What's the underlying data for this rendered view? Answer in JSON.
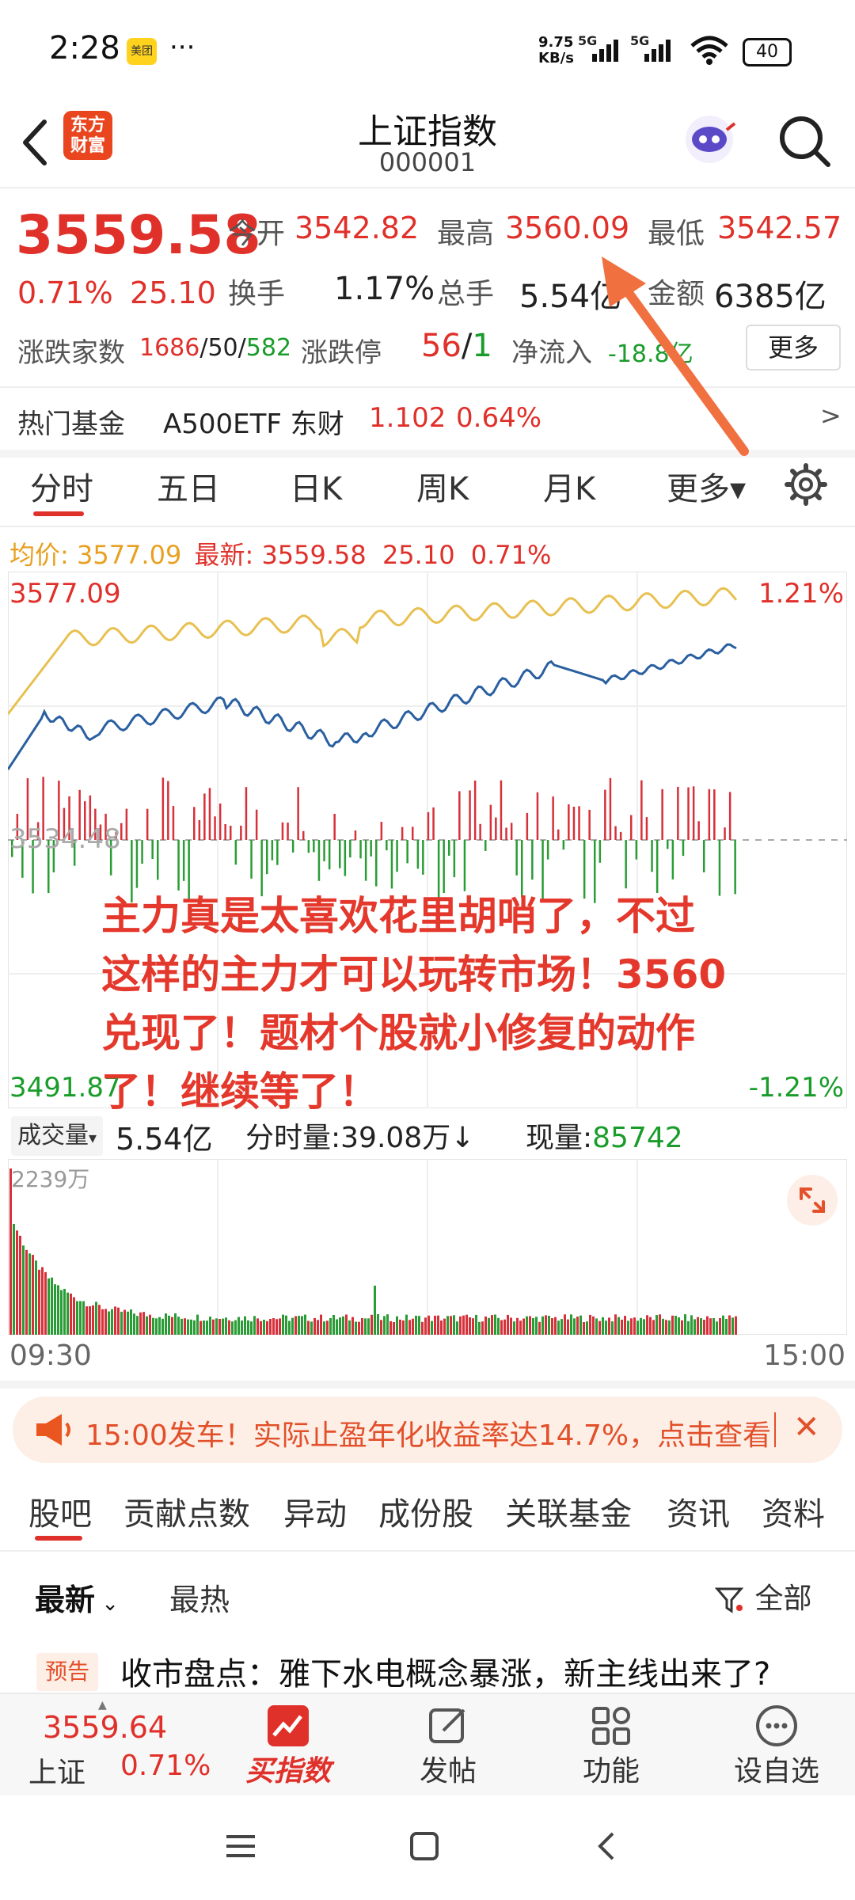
{
  "status_bar": {
    "time": "2:28",
    "app_badge": "美团",
    "dots": "···",
    "net_speed_top": "9.75",
    "net_speed_bottom": "KB/s",
    "sig1": "5G",
    "sig2": "5G",
    "battery": "40"
  },
  "header": {
    "title": "上证指数",
    "code": "000001",
    "logo_line1": "东方",
    "logo_line2": "财富"
  },
  "quote": {
    "price": "3559.58",
    "change_pct": "0.71%",
    "change": "25.10",
    "open_label": "今开",
    "open": "3542.82",
    "high_label": "最高",
    "high": "3560.09",
    "low_label": "最低",
    "low": "3542.57",
    "turnover_label": "换手",
    "turnover": "1.17%",
    "volume_label": "总手",
    "volume": "5.54亿",
    "amount_label": "金额",
    "amount": "6385亿",
    "breadth_label": "涨跌家数",
    "up_count": "1686",
    "flat_count": "50",
    "down_count": "582",
    "slash": "/",
    "limit_label": "涨跌停",
    "limit_up": "56",
    "limit_down": "1",
    "netflow_label": "净流入",
    "netflow": "-18.8亿",
    "more_button": "更多"
  },
  "hot_fund": {
    "label": "热门基金",
    "name": "A500ETF 东财",
    "price": "1.102",
    "pct": "0.64%",
    "arrow": ">"
  },
  "chart_tabs": [
    "分时",
    "五日",
    "日K",
    "周K",
    "月K",
    "更多▾"
  ],
  "chart_info": {
    "avg_label": "均价:",
    "avg": "3577.09",
    "latest_label": "最新:",
    "latest": "3559.58",
    "change": "25.10",
    "pct": "0.71%"
  },
  "chart_labels": {
    "top_price": "3577.09",
    "top_pct": "1.21%",
    "mid_price": "3534.48",
    "bottom_price": "3491.87",
    "bottom_pct": "-1.21%"
  },
  "annotation_text": [
    "主力真是太喜欢花里胡哨了，不过",
    "这样的主力才可以玩转市场！3560",
    "兑现了！题材个股就小修复的动作",
    "了！继续等了！"
  ],
  "volume_bar": {
    "selector": "成交量",
    "total": "5.54亿",
    "tick_label": "分时量:",
    "tick_value": "39.08万",
    "arrow": "↓",
    "current_label": "现量:",
    "current_value": "85742",
    "max_label": "2239万"
  },
  "time_axis": {
    "start": "09:30",
    "end": "15:00"
  },
  "banner": {
    "text": "15:00发车！实际止盈年化收益率达14.7%，点击查看",
    "close": "✕"
  },
  "section_tabs": [
    "股吧",
    "贡献点数",
    "异动",
    "成份股",
    "关联基金",
    "资讯",
    "资料"
  ],
  "feed": {
    "sort_latest": "最新",
    "sort_hot": "最热",
    "filter": "全部",
    "tag": "预告",
    "headline": "收市盘点：雅下水电概念暴涨，新主线出来了?"
  },
  "bottom_nav": {
    "index_price": "3559.64",
    "index_name": "上证",
    "index_pct": "0.71%",
    "buy_label": "买指数",
    "post_label": "发帖",
    "func_label": "功能",
    "watch_label": "设自选"
  },
  "colors": {
    "accent": "#e0302a",
    "green": "#1a9c2b",
    "orange": "#f07020",
    "avg_line": "#e8c050",
    "price_line": "#2a5fa0"
  }
}
